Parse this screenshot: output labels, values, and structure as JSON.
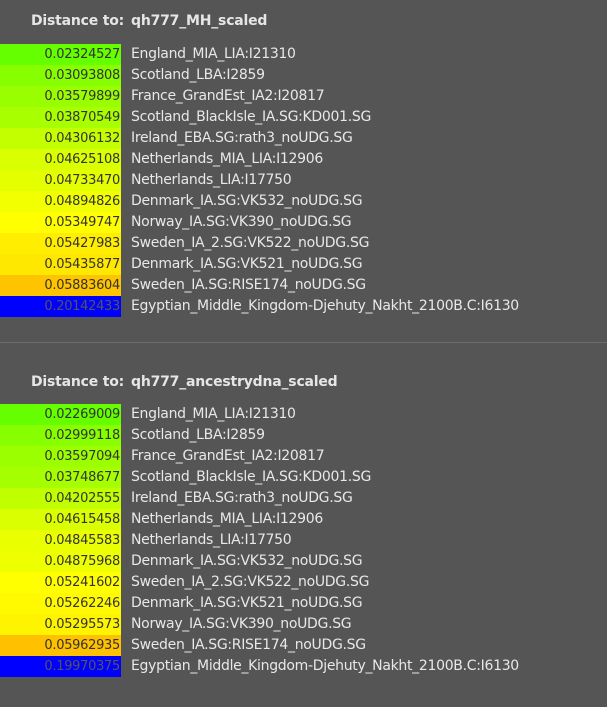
{
  "panels": [
    {
      "distance_label": "Distance to:",
      "target": "qh777_MH_scaled",
      "rows": [
        {
          "value": "0.02324527",
          "name": "England_MIA_LIA:I21310",
          "color": "#66ff00"
        },
        {
          "value": "0.03093808",
          "name": "Scotland_LBA:I2859",
          "color": "#88ff00"
        },
        {
          "value": "0.03579899",
          "name": "France_GrandEst_IA2:I20817",
          "color": "#99ff00"
        },
        {
          "value": "0.03870549",
          "name": "Scotland_BlackIsle_IA.SG:KD001.SG",
          "color": "#a8ff00"
        },
        {
          "value": "0.04306132",
          "name": "Ireland_EBA.SG:rath3_noUDG.SG",
          "color": "#c4ff00"
        },
        {
          "value": "0.04625108",
          "name": "Netherlands_MIA_LIA:I12906",
          "color": "#daff00"
        },
        {
          "value": "0.04733470",
          "name": "Netherlands_LIA:I17750",
          "color": "#e4ff00"
        },
        {
          "value": "0.04894826",
          "name": "Denmark_IA.SG:VK532_noUDG.SG",
          "color": "#f2ff00"
        },
        {
          "value": "0.05349747",
          "name": "Norway_IA.SG:VK390_noUDG.SG",
          "color": "#ffff00"
        },
        {
          "value": "0.05427983",
          "name": "Sweden_IA_2.SG:VK522_noUDG.SG",
          "color": "#ffee00"
        },
        {
          "value": "0.05435877",
          "name": "Denmark_IA.SG:VK521_noUDG.SG",
          "color": "#ffe800"
        },
        {
          "value": "0.05883604",
          "name": "Sweden_IA.SG:RISE174_noUDG.SG",
          "color": "#ffc400"
        },
        {
          "value": "0.20142433",
          "name": "Egyptian_Middle_Kingdom-Djehuty_Nakht_2100B.C:I6130",
          "color": "#0000ff",
          "dark": true
        }
      ]
    },
    {
      "distance_label": "Distance to:",
      "target": "qh777_ancestrydna_scaled",
      "rows": [
        {
          "value": "0.02269009",
          "name": "England_MIA_LIA:I21310",
          "color": "#66ff00"
        },
        {
          "value": "0.02999118",
          "name": "Scotland_LBA:I2859",
          "color": "#88ff00"
        },
        {
          "value": "0.03597094",
          "name": "France_GrandEst_IA2:I20817",
          "color": "#9cff00"
        },
        {
          "value": "0.03748677",
          "name": "Scotland_BlackIsle_IA.SG:KD001.SG",
          "color": "#a6ff00"
        },
        {
          "value": "0.04202555",
          "name": "Ireland_EBA.SG:rath3_noUDG.SG",
          "color": "#c0ff00"
        },
        {
          "value": "0.04615458",
          "name": "Netherlands_MIA_LIA:I12906",
          "color": "#daff00"
        },
        {
          "value": "0.04845583",
          "name": "Netherlands_LIA:I17750",
          "color": "#eaff00"
        },
        {
          "value": "0.04875968",
          "name": "Denmark_IA.SG:VK532_noUDG.SG",
          "color": "#eeff00"
        },
        {
          "value": "0.05241602",
          "name": "Sweden_IA_2.SG:VK522_noUDG.SG",
          "color": "#ffff00"
        },
        {
          "value": "0.05262246",
          "name": "Denmark_IA.SG:VK521_noUDG.SG",
          "color": "#fffa00"
        },
        {
          "value": "0.05295573",
          "name": "Norway_IA.SG:VK390_noUDG.SG",
          "color": "#fff400"
        },
        {
          "value": "0.05962935",
          "name": "Sweden_IA.SG:RISE174_noUDG.SG",
          "color": "#ffc000"
        },
        {
          "value": "0.19970375",
          "name": "Egyptian_Middle_Kingdom-Djehuty_Nakht_2100B.C:I6130",
          "color": "#0000ff",
          "dark": true
        }
      ]
    }
  ]
}
